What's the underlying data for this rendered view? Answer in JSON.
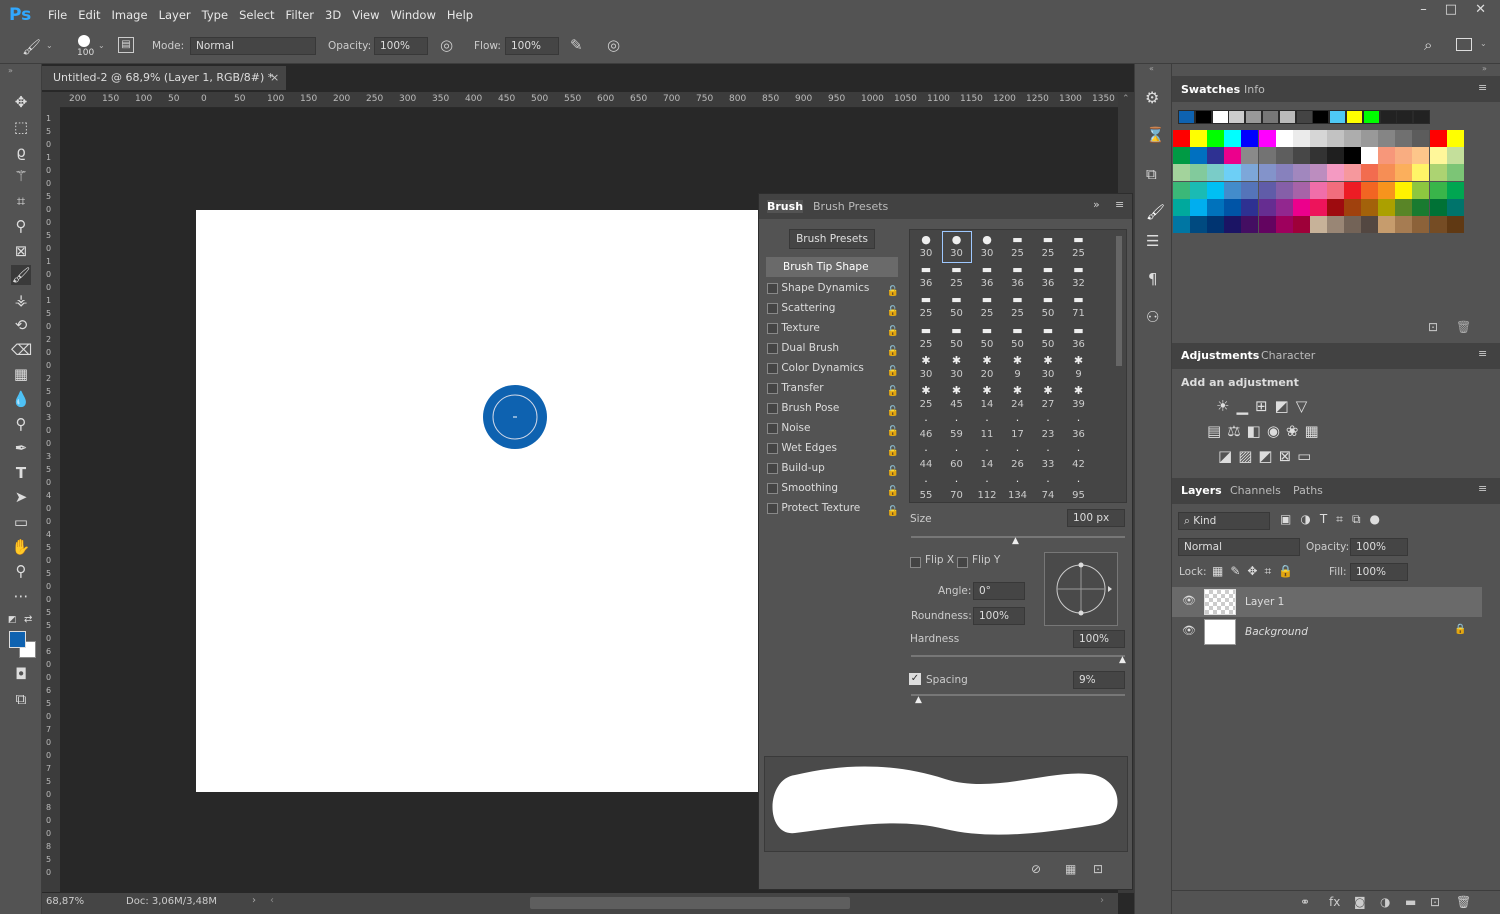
{
  "app": {
    "logo": "Ps"
  },
  "menu": [
    "File",
    "Edit",
    "Image",
    "Layer",
    "Type",
    "Select",
    "Filter",
    "3D",
    "View",
    "Window",
    "Help"
  ],
  "window_controls": {
    "minimize": "–",
    "maximize": "□",
    "close": "✕"
  },
  "options": {
    "brush_size": "100",
    "mode_label": "Mode:",
    "mode_value": "Normal",
    "opacity_label": "Opacity:",
    "opacity_value": "100%",
    "flow_label": "Flow:",
    "flow_value": "100%"
  },
  "document": {
    "tab_title": "Untitled-2 @ 68,9% (Layer 1, RGB/8#) *",
    "zoom": "68,87%",
    "doc_size": "Doc: 3,06M/3,48M",
    "ruler_h": [
      "200",
      "150",
      "100",
      "50",
      "0",
      "50",
      "100",
      "150",
      "200",
      "250",
      "300",
      "350",
      "400",
      "450",
      "500",
      "550",
      "600",
      "650",
      "700",
      "750",
      "800",
      "850",
      "900",
      "950",
      "1000",
      "1050",
      "1100",
      "1150",
      "1200",
      "1250",
      "1300",
      "1350"
    ],
    "ruler_v": [
      "1",
      "5",
      "0",
      "1",
      "0",
      "0",
      "5",
      "0",
      "0",
      "5",
      "0",
      "1",
      "0",
      "0",
      "1",
      "5",
      "0",
      "2",
      "0",
      "0",
      "2",
      "5",
      "0",
      "3",
      "0",
      "0",
      "3",
      "5",
      "0",
      "4",
      "0",
      "0",
      "4",
      "5",
      "0",
      "5",
      "0",
      "0",
      "5",
      "5",
      "0",
      "6",
      "0",
      "0",
      "6",
      "5",
      "0",
      "7",
      "0",
      "0",
      "7",
      "5",
      "0",
      "8",
      "0",
      "0",
      "8",
      "5",
      "0"
    ]
  },
  "brush_panel": {
    "tabs": [
      "Brush",
      "Brush Presets"
    ],
    "presets_button": "Brush Presets",
    "tip_shape": "Brush Tip Shape",
    "options": [
      "Shape Dynamics",
      "Scattering",
      "Texture",
      "Dual Brush",
      "Color Dynamics",
      "Transfer",
      "Brush Pose",
      "Noise",
      "Wet Edges",
      "Build-up",
      "Smoothing",
      "Protect Texture"
    ],
    "tip_sizes": [
      "30",
      "30",
      "30",
      "25",
      "25",
      "25",
      "36",
      "25",
      "36",
      "36",
      "36",
      "32",
      "25",
      "50",
      "25",
      "25",
      "50",
      "71",
      "25",
      "50",
      "50",
      "50",
      "50",
      "36",
      "30",
      "30",
      "20",
      "9",
      "30",
      "9",
      "25",
      "45",
      "14",
      "24",
      "27",
      "39",
      "46",
      "59",
      "11",
      "17",
      "23",
      "36",
      "44",
      "60",
      "14",
      "26",
      "33",
      "42",
      "55",
      "70",
      "112",
      "134",
      "74",
      "95"
    ],
    "size_label": "Size",
    "size_value": "100 px",
    "flip_x": "Flip X",
    "flip_y": "Flip Y",
    "angle_label": "Angle:",
    "angle_value": "0°",
    "roundness_label": "Roundness:",
    "roundness_value": "100%",
    "hardness_label": "Hardness",
    "hardness_value": "100%",
    "spacing_label": "Spacing",
    "spacing_value": "9%"
  },
  "swatches_panel": {
    "tabs": [
      "Swatches",
      "Info"
    ],
    "row0": [
      "#0e62b0",
      "#000000",
      "#ffffff",
      "#cccccc",
      "#999999",
      "#777777",
      "#bbbbbb",
      "#444444",
      "#000000",
      "#4ec9f5",
      "#ffff00",
      "#00ff00",
      "#222222",
      "#222222",
      "#222222"
    ],
    "grid": [
      [
        "#ff0000",
        "#ffff00",
        "#00ff00",
        "#00ffff",
        "#0000ff",
        "#ff00ff",
        "#ffffff",
        "#ebebeb",
        "#d6d6d6",
        "#c2c2c2",
        "#adadad",
        "#999999",
        "#858585",
        "#707070",
        "#5c5c5c",
        "#ff0000",
        "#ffff00"
      ],
      [
        "#009a44",
        "#0070c0",
        "#2e3192",
        "#ec008c",
        "#8a8a8a",
        "#737373",
        "#5e5e5e",
        "#474747",
        "#333333",
        "#1f1f1f",
        "#000000",
        "#ffffff",
        "#f7977a",
        "#f9ad81",
        "#fdc68a",
        "#fff79a",
        "#c4df9b"
      ],
      [
        "#a3d39c",
        "#82ca9c",
        "#7accc8",
        "#6dcff6",
        "#7da7d9",
        "#8393ca",
        "#8781bd",
        "#a187be",
        "#bc8dbf",
        "#f49ac2",
        "#f6989d",
        "#f26c4f",
        "#f68e55",
        "#fbaf5c",
        "#fff467",
        "#acd372",
        "#7cc576"
      ],
      [
        "#3bb878",
        "#1abbb4",
        "#00bff3",
        "#438ccb",
        "#5574b9",
        "#605ca8",
        "#855fa8",
        "#a763a8",
        "#f06ea9",
        "#f26d7d",
        "#ed1c24",
        "#f26522",
        "#f7941d",
        "#fff200",
        "#8dc73f",
        "#39b54a",
        "#00a651"
      ],
      [
        "#00a99d",
        "#00aeef",
        "#0072bc",
        "#0054a6",
        "#2e3192",
        "#662d91",
        "#92278f",
        "#ec008c",
        "#ed145b",
        "#9e0b0f",
        "#a0410d",
        "#a3620a",
        "#aba000",
        "#598527",
        "#197b30",
        "#007236",
        "#00746b"
      ],
      [
        "#0076a3",
        "#004a80",
        "#003471",
        "#1b1464",
        "#440e62",
        "#630460",
        "#9e005d",
        "#9e0039",
        "#c7b299",
        "#998675",
        "#736357",
        "#534741",
        "#c69c6d",
        "#a67c52",
        "#8c6239",
        "#754c24",
        "#603913"
      ]
    ]
  },
  "adjustments_panel": {
    "tabs": [
      "Adjustments",
      "Character"
    ],
    "title": "Add an adjustment"
  },
  "layers_panel": {
    "tabs": [
      "Layers",
      "Channels",
      "Paths"
    ],
    "kind": "Kind",
    "blend_mode": "Normal",
    "opacity_label": "Opacity:",
    "opacity_value": "100%",
    "lock_label": "Lock:",
    "fill_label": "Fill:",
    "fill_value": "100%",
    "layers": [
      {
        "name": "Layer 1"
      },
      {
        "name": "Background"
      }
    ]
  },
  "colors": {
    "foreground": "#0e62b0",
    "background": "#ffffff",
    "brush_dot": "#0e62b0"
  }
}
